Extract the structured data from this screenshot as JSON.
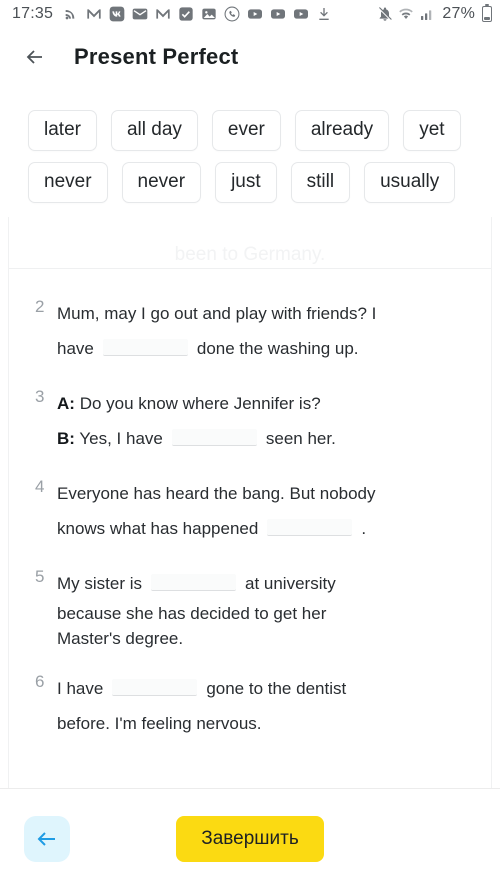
{
  "status_bar": {
    "clock": "17:35",
    "battery_percent": "27%",
    "left_icons": [
      "rss-cast-icon",
      "gmail-icon",
      "vk-icon",
      "mail-envelope-icon",
      "gmail-icon",
      "checkbox-icon",
      "photo-icon",
      "viber-icon",
      "youtube-icon",
      "youtube-icon",
      "youtube-icon",
      "download-icon"
    ],
    "right_icons": [
      "notifications-muted-icon",
      "wifi-icon",
      "signal-bars-icon",
      "battery-icon"
    ]
  },
  "appbar": {
    "back_label": "back-arrow",
    "title": "Present Perfect"
  },
  "word_bank": {
    "chips": [
      "later",
      "all day",
      "ever",
      "already",
      "yet",
      "never",
      "never",
      "just",
      "still",
      "usually"
    ]
  },
  "exercise": {
    "ghost_text": "been to Germany.",
    "questions": [
      {
        "number": "2",
        "line1_before": "Mum, may I go out and play with friends? I",
        "line2_before": "have",
        "line2_after": "done the washing up."
      },
      {
        "number": "3",
        "speaker_a": "A:",
        "line_a": "Do you know where Jennifer is?",
        "speaker_b": "B:",
        "line_b_before": "Yes, I have",
        "line_b_after": "seen her."
      },
      {
        "number": "4",
        "line1": "Everyone has heard the bang. But nobody",
        "line2_before": "knows what has happened",
        "line2_after": "."
      },
      {
        "number": "5",
        "line1_before": "My sister is",
        "line1_after": "at university",
        "line2": "because she has decided to get her",
        "line3": "Master's degree."
      },
      {
        "number": "6",
        "line1_before": "I have",
        "line1_after": "gone to the dentist",
        "line2": "before. I'm feeling nervous."
      }
    ]
  },
  "bottom_bar": {
    "prev_label": "previous-arrow",
    "finish_label": "Завершить",
    "finish_color": "#fbda12",
    "prev_bg_color": "#dff5fd"
  }
}
